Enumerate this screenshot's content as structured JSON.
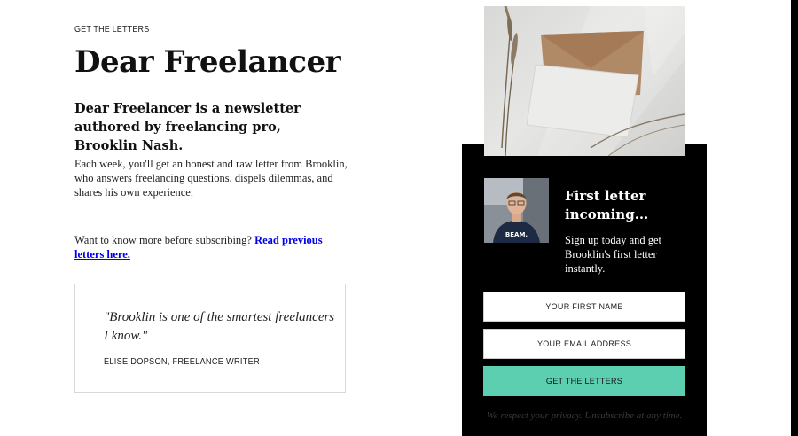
{
  "hero": {
    "eyebrow": "GET THE LETTERS",
    "title": "Dear Freelancer",
    "subtitle": "Dear Freelancer is a newsletter authored by freelancing pro, Brooklin Nash.",
    "body": "Each week, you'll get an honest and raw letter from Brooklin, who answers freelancing questions, dispels dilemmas, and shares his own experience.",
    "more_prefix": "Want to know more before subscribing? ",
    "more_link": "Read previous letters here."
  },
  "testimonial": {
    "quote": "\"Brooklin is one of the smartest freelancers I know.\"",
    "author": "ELISE DOPSON, FREELANCE WRITER"
  },
  "signup": {
    "heading": "First letter incoming...",
    "text": "Sign up today and get Brooklin's first letter instantly.",
    "first_name_placeholder": "YOUR FIRST NAME",
    "email_placeholder": "YOUR EMAIL ADDRESS",
    "submit_label": "GET THE LETTERS",
    "privacy": "We respect your privacy. Unsubscribe at any time.",
    "avatar_shirt_text": "BEAM."
  },
  "colors": {
    "accent": "#5ccfb1",
    "panel_bg": "#000000",
    "link": "#0000ee"
  },
  "icons": {
    "hero_image": "envelope-photo",
    "avatar": "author-photo"
  }
}
